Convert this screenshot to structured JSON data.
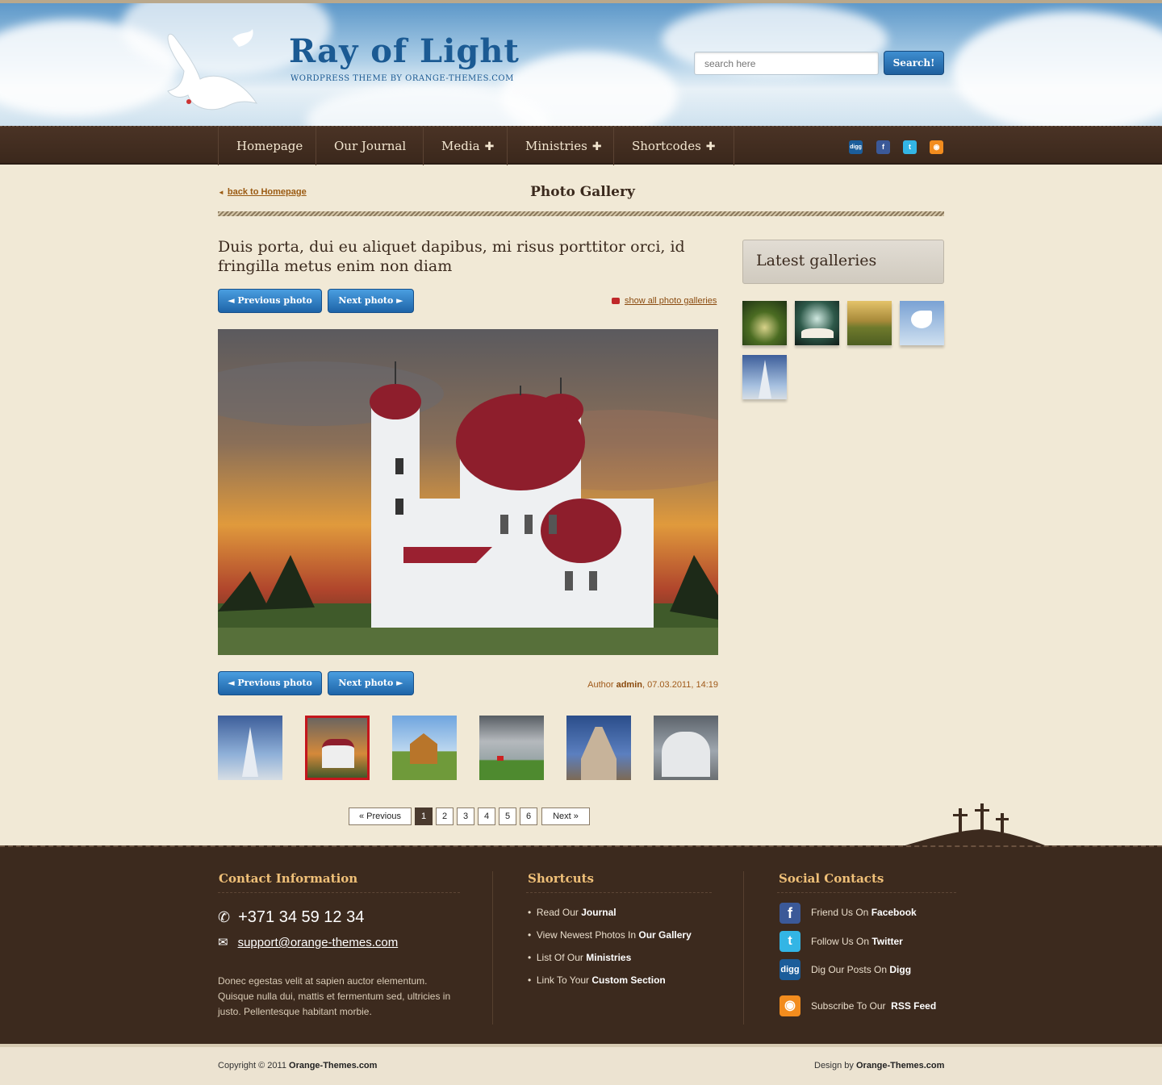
{
  "header": {
    "logo_main": "Ray of Light",
    "logo_sub": "WORDPRESS THEME BY ORANGE-THEMES.COM",
    "search_placeholder": "search here",
    "search_button": "Search!"
  },
  "nav": {
    "items": [
      {
        "label": "Homepage",
        "has_submenu": false
      },
      {
        "label": "Our Journal",
        "has_submenu": false
      },
      {
        "label": "Media",
        "has_submenu": true
      },
      {
        "label": "Ministries",
        "has_submenu": true
      },
      {
        "label": "Shortcodes",
        "has_submenu": true
      }
    ],
    "social_icons": [
      "digg-icon",
      "facebook-icon",
      "twitter-icon",
      "rss-icon"
    ]
  },
  "content": {
    "back_link": "back to Homepage",
    "page_heading": "Photo Gallery",
    "post_title": "Duis porta, dui eu aliquet dapibus, mi risus porttitor orci, id fringilla metus enim non diam",
    "prev_button": "◄  Previous photo",
    "next_button": "Next photo  ►",
    "show_all_link": "show all photo galleries",
    "author_prefix": "Author",
    "author_name": "admin",
    "author_date": ", 07.03.2011, 14:19",
    "thumbnails": [
      "church-tower-thumb",
      "red-dome-church-thumb",
      "wooden-church-thumb",
      "coast-chapel-thumb",
      "cathedral-thumb",
      "white-church-thumb"
    ],
    "active_thumbnail": 1,
    "pagination": {
      "previous": "« Previous",
      "pages": [
        "1",
        "2",
        "3",
        "4",
        "5",
        "6"
      ],
      "current": "1",
      "next": "Next »"
    }
  },
  "sidebar": {
    "heading": "Latest galleries",
    "galleries": [
      "forest-path-thumb",
      "open-book-thumb",
      "chapel-field-thumb",
      "dove-thumb",
      "church-spire-thumb"
    ]
  },
  "footer": {
    "contact": {
      "heading": "Contact Information",
      "phone": "+371 34 59 12 34",
      "email": "support@orange-themes.com",
      "text": "Donec egestas velit at sapien auctor elementum. Quisque nulla dui, mattis et fermentum sed, ultricies in justo. Pellentesque habitant morbie."
    },
    "shortcuts": {
      "heading": "Shortcuts",
      "items": [
        {
          "text": "Read Our ",
          "bold": "Journal"
        },
        {
          "text": "View Newest Photos In ",
          "bold": "Our Gallery"
        },
        {
          "text": "List Of Our ",
          "bold": "Ministries"
        },
        {
          "text": "Link To Your ",
          "bold": "Custom Section"
        }
      ]
    },
    "social": {
      "heading": "Social Contacts",
      "items": [
        {
          "text": "Friend Us On ",
          "bold": "Facebook",
          "icon": "facebook-icon"
        },
        {
          "text": "Follow Us On ",
          "bold": "Twitter",
          "icon": "twitter-icon"
        },
        {
          "text": "Dig Our Posts On ",
          "bold": "Digg",
          "icon": "digg-icon"
        },
        {
          "text": "Subscribe To Our  ",
          "bold": "RSS Feed",
          "icon": "rss-icon"
        }
      ]
    }
  },
  "bottom": {
    "copyright_prefix": "Copyright © 2011 ",
    "copyright_site": "Orange-Themes.com",
    "design_prefix": "Design by ",
    "design_site": "Orange-Themes.com"
  },
  "colors": {
    "nav_bg": "#3b281c",
    "accent_blue": "#1e64a8",
    "link_orange": "#9a5a12",
    "footer_heading": "#f0c078",
    "active_thumb_border": "#c4161c"
  }
}
